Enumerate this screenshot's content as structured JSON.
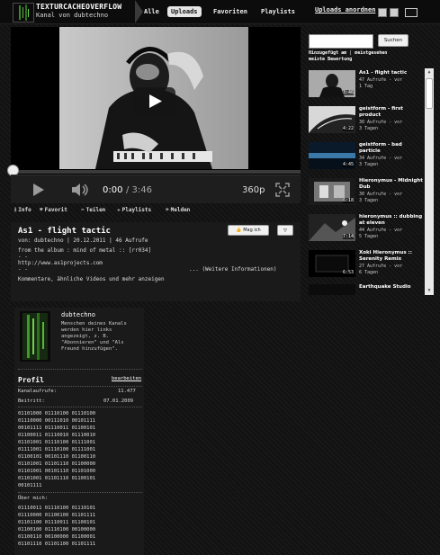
{
  "header": {
    "channel_title": "TEXTURCACHEOVERFLOW",
    "channel_subtitle": "Kanal von dubtechno",
    "tabs": [
      {
        "label": "Alle",
        "active": false
      },
      {
        "label": "Uploads",
        "active": true
      },
      {
        "label": "Favoriten",
        "active": false
      },
      {
        "label": "Playlists",
        "active": false
      }
    ],
    "sort_label": "Uploads anordnen",
    "view_icons": [
      "grid-view-icon",
      "list-view-icon",
      "compact-view-icon"
    ]
  },
  "player": {
    "time_current": "0:00",
    "time_separator_total": "/ 3:46",
    "progress_fraction": 0.0,
    "quality": "360p",
    "icons": [
      "play-icon",
      "volume-icon",
      "fullscreen-icon",
      "big-play-icon"
    ]
  },
  "actions": [
    {
      "icon": "info-icon",
      "glyph": "ℹ",
      "label": "Info"
    },
    {
      "icon": "heart-icon",
      "glyph": "♥",
      "label": "Favorit"
    },
    {
      "icon": "share-icon",
      "glyph": "➦",
      "label": "Teilen"
    },
    {
      "icon": "add-icon",
      "glyph": "✚",
      "label": "Playlists"
    },
    {
      "icon": "flag-icon",
      "glyph": "⚑",
      "label": "Melden"
    }
  ],
  "video_info": {
    "title": "As1 - flight tactic",
    "like_label": "Mag ich",
    "meta_line": "von: dubtechno  |  20.12.2011  |  46 Aufrufe",
    "desc_line1": "from the album : mind of metal :: [rr034]",
    "desc_line2": "- -",
    "desc_link": "http://www.as1projects.com",
    "desc_line4": "- -",
    "more_info": "... (Weitere Informationen)",
    "comments_link": "Kommentare, ähnliche Videos und mehr anzeigen"
  },
  "profile": {
    "name": "dubtechno",
    "description": "Menschen deines Kanals werden hier links angezeigt, z. B. \"Abonnieren\" und \"Als Freund hinzufügen\".",
    "heading": "Profil",
    "edit_label": "bearbeiten",
    "views_label": "Kanalaufrufe:",
    "views_value": "11.477",
    "joined_label": "Beitritt:",
    "joined_value": "07.01.2009",
    "binary_block_1": "01101000 01110100 01110100\n01110000 00111010 00101111\n00101111 01110011 01100101\n01100011 01110010 01110010\n01101001 01110100 01111001\n01111001 01110100 01111001\n01100101 00101110 01100110\n01101001 01101110 01100000\n01101001 00101110 01101000\n01101001 01101110 01100101\n00101111",
    "about_label": "Über mich:",
    "binary_block_2": "01110011 01110100 01110101\n01110000 01100100 01101111\n01101100 01110011 01100101\n01100100 01110100 00100000\n01100110 00100000 01100001\n01101110 01101100 01101111"
  },
  "sidebar": {
    "search_placeholder": "",
    "search_button": "Suchen",
    "sort_text_1": "Hinzugefügt am",
    "sort_sep": " | ",
    "sort_text_2": "meistgesehen",
    "sort_text_3": "meiste Bewertung",
    "videos": [
      {
        "title": "As1 - flight tactic",
        "views": "47 Aufrufe - vor",
        "age": "1 Tag",
        "duration": "3:46"
      },
      {
        "title": "geistform - first product",
        "views": "30 Aufrufe - vor",
        "age": "3 Tagen",
        "duration": "4:22"
      },
      {
        "title": "geistform - bad particle",
        "views": "34 Aufrufe - vor",
        "age": "3 Tagen",
        "duration": "4:45"
      },
      {
        "title": "Hieronymus - Midnight Dub",
        "views": "30 Aufrufe - vor",
        "age": "3 Tagen",
        "duration": "6:18"
      },
      {
        "title": "hieronymus :: dubbing at eleven",
        "views": "44 Aufrufe - vor",
        "age": "5 Tagen",
        "duration": "7:14"
      },
      {
        "title": "Xoki Hieronymus :: Serenity Remix",
        "views": "27 Aufrufe - vor",
        "age": "6 Tagen",
        "duration": "6:53"
      },
      {
        "title": "Earthquake Studio",
        "views": "",
        "age": "",
        "duration": ""
      }
    ]
  },
  "colors": {
    "background": "#141414",
    "panel": "#1a1a1a",
    "text": "#dddddd",
    "active_tab": "#e6e6e6"
  }
}
